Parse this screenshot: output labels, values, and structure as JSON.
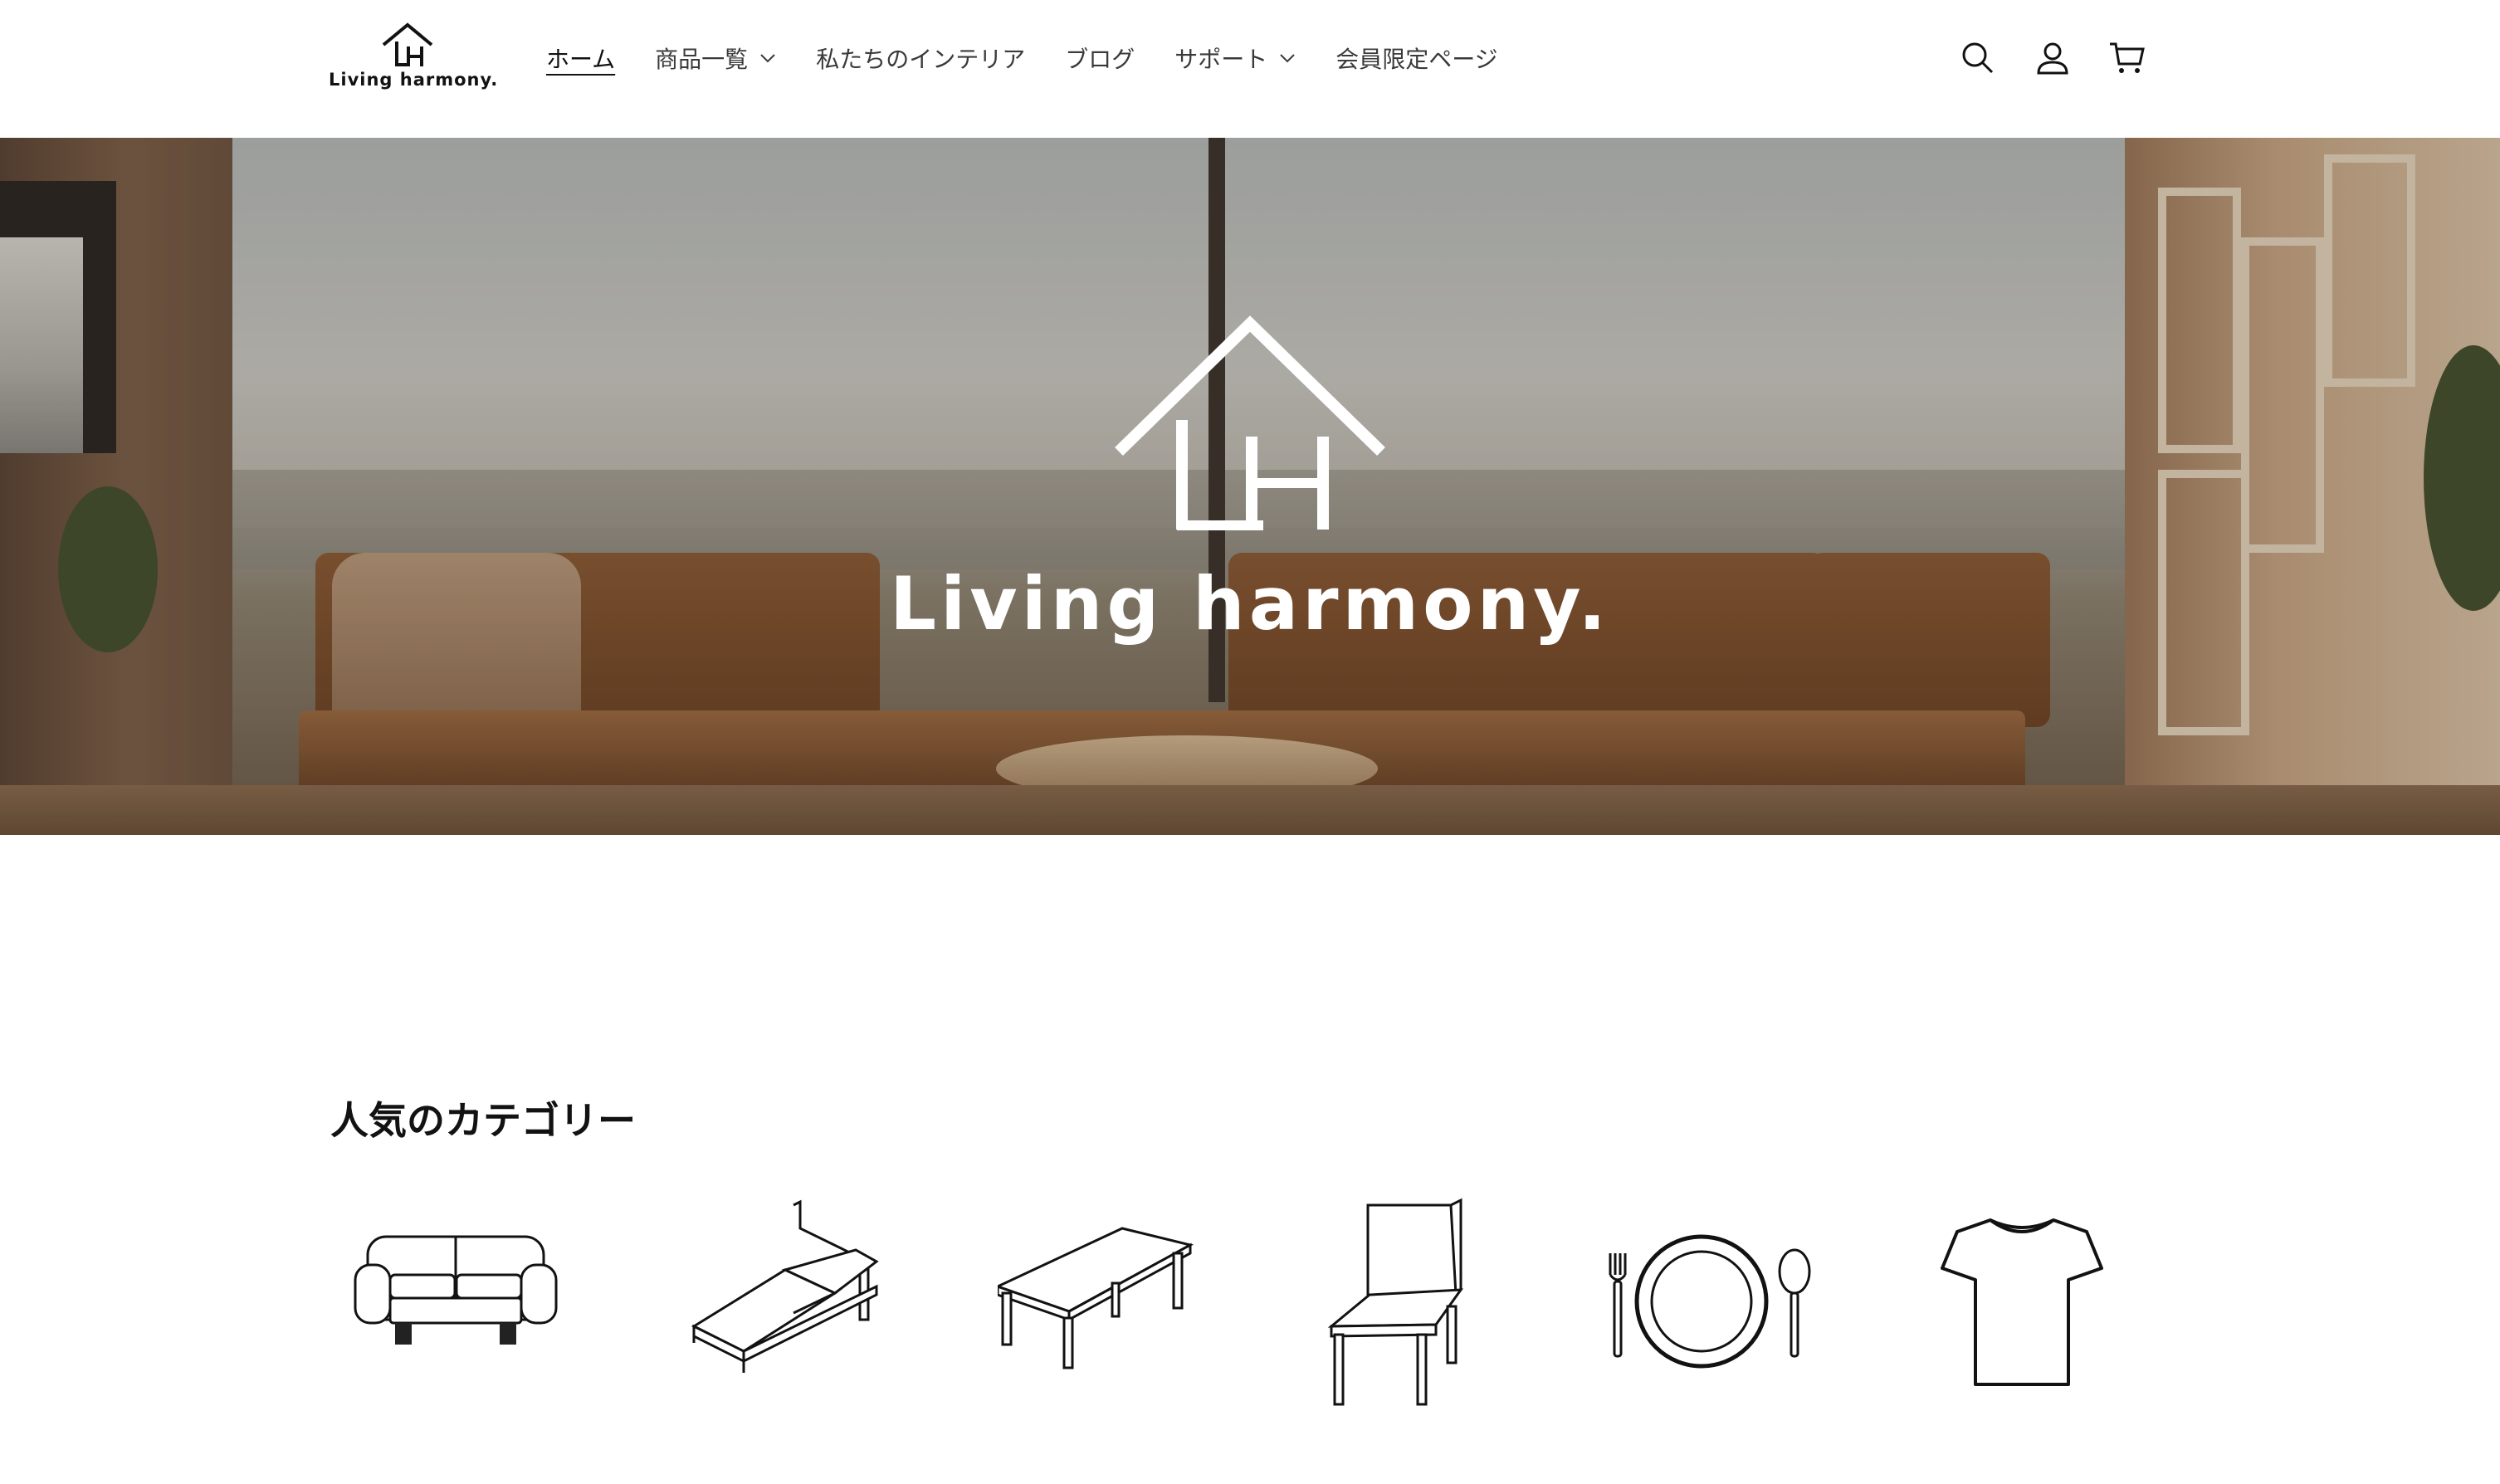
{
  "header": {
    "logo_text": "Living harmony.",
    "nav": [
      {
        "label": "ホーム",
        "active": true,
        "has_dropdown": false
      },
      {
        "label": "商品一覧",
        "active": false,
        "has_dropdown": true
      },
      {
        "label": "私たちのインテリア",
        "active": false,
        "has_dropdown": false
      },
      {
        "label": "ブログ",
        "active": false,
        "has_dropdown": false
      },
      {
        "label": "サポート",
        "active": false,
        "has_dropdown": true
      },
      {
        "label": "会員限定ページ",
        "active": false,
        "has_dropdown": false
      }
    ],
    "icons": [
      "search-icon",
      "account-icon",
      "cart-icon"
    ]
  },
  "hero": {
    "brand": "Living harmony."
  },
  "categories": {
    "title": "人気のカテゴリー",
    "items": [
      {
        "icon": "sofa-icon"
      },
      {
        "icon": "bed-icon"
      },
      {
        "icon": "table-icon"
      },
      {
        "icon": "chair-icon"
      },
      {
        "icon": "tableware-icon"
      },
      {
        "icon": "tshirt-icon"
      }
    ]
  }
}
